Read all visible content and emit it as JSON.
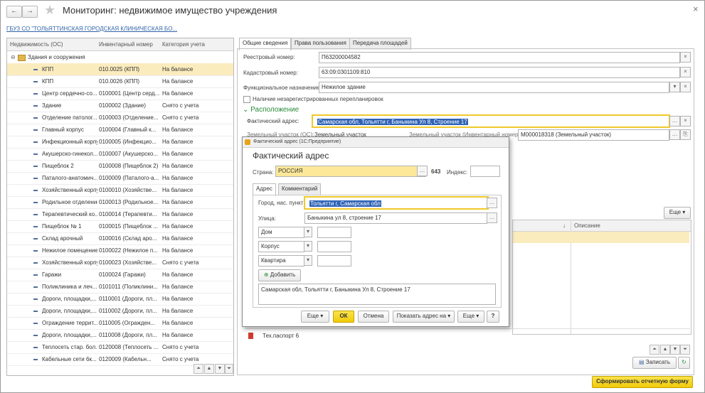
{
  "window": {
    "title": "Мониторинг: недвижимое имущество учреждения",
    "close_glyph": "×"
  },
  "org_link": "ГБУЗ СО \"ТОЛЬЯТТИНСКАЯ ГОРОДСКАЯ КЛИНИЧЕСКАЯ БО...",
  "left_grid": {
    "columns": [
      "Недвижимость (ОС)",
      "Инвентарный номер",
      "Категория учета"
    ],
    "group": "Здания и сооружения",
    "rows": [
      {
        "name": "КПП",
        "inv": "010.0025 (КПП)",
        "cat": "На балансе"
      },
      {
        "name": "КПП",
        "inv": "010.0026 (КПП)",
        "cat": "На балансе"
      },
      {
        "name": "Центр сердечно-со...",
        "inv": "0100001 (Центр серд...",
        "cat": "На балансе"
      },
      {
        "name": "Здание",
        "inv": "0100002 (Здание)",
        "cat": "Снято с учета"
      },
      {
        "name": "Отделение патолог...",
        "inv": "0100003 (Отделение...",
        "cat": "Снято с учета"
      },
      {
        "name": "Главный корпус",
        "inv": "0100004 (Главный к...",
        "cat": "На балансе"
      },
      {
        "name": "Инфекционный корпус",
        "inv": "0100005 (Инфекцио...",
        "cat": "На балансе"
      },
      {
        "name": "Акушерско-гинекол...",
        "inv": "0100007 (Акушерско...",
        "cat": "На балансе"
      },
      {
        "name": "Пищеблок 2",
        "inv": "0100008 (Пищеблок 2)",
        "cat": "На балансе"
      },
      {
        "name": "Паталого-анатомич...",
        "inv": "0100009 (Паталого-а...",
        "cat": "На балансе"
      },
      {
        "name": "Хозяйственный корпус",
        "inv": "0100010 (Хозяйстве...",
        "cat": "На балансе"
      },
      {
        "name": "Родильное отделение",
        "inv": "0100013 (Родильное...",
        "cat": "На балансе"
      },
      {
        "name": "Терапевтический ко...",
        "inv": "0100014 (Терапевти...",
        "cat": "На балансе"
      },
      {
        "name": "Пищеблок № 1",
        "inv": "0100015 (Пищеблок ...",
        "cat": "На балансе"
      },
      {
        "name": "Склад арочный",
        "inv": "0100016 (Склад аро...",
        "cat": "На балансе"
      },
      {
        "name": "Нежилое помещение",
        "inv": "0100022 (Нежилое п...",
        "cat": "На балансе"
      },
      {
        "name": "Хозяйственный корпус",
        "inv": "0100023 (Хозяйстве...",
        "cat": "Снято с учета"
      },
      {
        "name": "Гаражи",
        "inv": "0100024 (Гаражи)",
        "cat": "На балансе"
      },
      {
        "name": "Поликлиника и леч...",
        "inv": "0101011 (Поликлини...",
        "cat": "На балансе"
      },
      {
        "name": "Дороги, площадки,...",
        "inv": "0110001 (Дороги, пл...",
        "cat": "На балансе"
      },
      {
        "name": "Дороги, площадки,...",
        "inv": "0110002 (Дороги, пл...",
        "cat": "На балансе"
      },
      {
        "name": "Ограждение террит...",
        "inv": "0110005 (Огражден...",
        "cat": "На балансе"
      },
      {
        "name": "Дороги, площадки,...",
        "inv": "0110008 (Дороги, пл...",
        "cat": "На балансе"
      },
      {
        "name": "Теплосеть стар. бол...",
        "inv": "0120008 (Теплосеть ...",
        "cat": "Снято с учета"
      },
      {
        "name": "Кабельные сети 6к...",
        "inv": "0120009 (Кабельн...",
        "cat": "Снято с учета"
      }
    ]
  },
  "tabs": [
    "Общие сведения",
    "Права пользования",
    "Передача площадей"
  ],
  "form": {
    "registry_label": "Реестровый номер:",
    "registry_value": "П63200004582",
    "cadastral_label": "Кадастровый номер:",
    "cadastral_value": "63:09:0301109:810",
    "purpose_label": "Функциональное назначение:",
    "purpose_value": "Нежилое здание",
    "replan_label": "Наличие незарегистрированных перепланировок",
    "location_section": "Расположение",
    "address_label": "Фактический адрес:",
    "address_value": "Самарская обл, Тольятти г, Баныкина Ул 8, Строение 17",
    "land_label": "Земельный участок (ОС):",
    "land_link": "Земельный участок",
    "land_inv_label": "Земельный участок (Инвентарный номер):",
    "land_inv_value": "М000018318 (Земельный участок)",
    "more_button": "Еще",
    "description_col": "Описание",
    "sort_glyph": "↓",
    "attachment": "Тех.паспорт 6",
    "save_button": "Записать",
    "report_button": "Сформировать отчетную форму"
  },
  "dialog": {
    "window_caption": "Фактический адрес (1С:Предприятие)",
    "title": "Фактический адрес",
    "country_label": "Страна:",
    "country_value": "РОССИЯ",
    "country_code": "643",
    "index_label": "Индекс:",
    "index_value": "",
    "tabs": [
      "Адрес",
      "Комментарий"
    ],
    "city_label": "Город, нас. пункт:",
    "city_value": "Тольятти г, Самарская обл",
    "street_label": "Улица:",
    "street_value": "Баныкина ул 8, строение 17",
    "dom": "Дом",
    "korpus": "Корпус",
    "kvartira": "Квартира",
    "add_button": "Добавить",
    "full_address": "Самарская обл, Тольятти г, Баныкина Ул 8, Строение 17",
    "more1": "Еще",
    "ok": "ОК",
    "cancel": "Отмена",
    "show_address": "Показать адрес на",
    "more2": "Еще",
    "help": "?"
  }
}
